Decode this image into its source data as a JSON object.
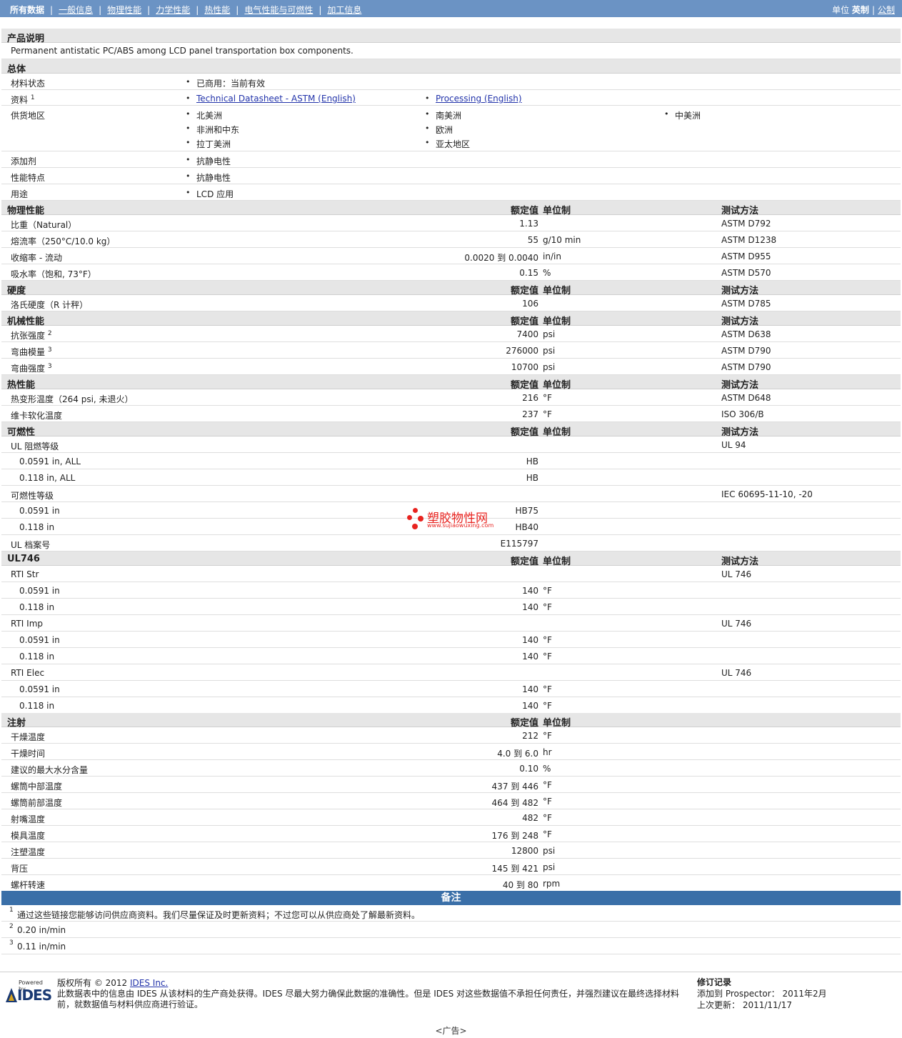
{
  "nav": {
    "tabs": [
      "所有数据",
      "一般信息",
      "物理性能",
      "力学性能",
      "热性能",
      "电气性能与可燃性",
      "加工信息"
    ],
    "units_label": "单位",
    "unit_selected": "英制",
    "unit_other": "公制"
  },
  "product": {
    "title": "产品说明",
    "description": "Permanent antistatic PC/ABS among LCD panel transportation box components."
  },
  "general": {
    "title": "总体",
    "material_status_label": "材料状态",
    "material_status": "已商用：当前有效",
    "docs_label": "资料",
    "docs_sup": "1",
    "doc1": "Technical Datasheet - ASTM (English)",
    "doc2": "Processing (English)",
    "region_label": "供货地区",
    "regions": [
      "北美洲",
      "南美洲",
      "中美洲",
      "非洲和中东",
      "欧洲",
      "拉丁美洲",
      "亚太地区"
    ],
    "additive_label": "添加剂",
    "additive": "抗静电性",
    "feature_label": "性能特点",
    "feature": "抗静电性",
    "use_label": "用途",
    "use": "LCD 应用"
  },
  "col": {
    "nominal": "额定值",
    "unit": "单位制",
    "test": "测试方法"
  },
  "physical": {
    "title": "物理性能",
    "rows": [
      {
        "label": "比重（Natural）",
        "nominal": "1.13",
        "unit": "",
        "test": "ASTM D792"
      },
      {
        "label": "熔流率（250°C/10.0 kg）",
        "nominal": "55",
        "unit": "g/10 min",
        "test": "ASTM D1238"
      },
      {
        "label": "收缩率 - 流动",
        "nominal": "0.0020 到  0.0040",
        "unit": "in/in",
        "test": "ASTM D955"
      },
      {
        "label": "吸水率（饱和, 73°F）",
        "nominal": "0.15",
        "unit": "%",
        "test": "ASTM D570"
      }
    ]
  },
  "hardness": {
    "title": "硬度",
    "rows": [
      {
        "label": "洛氏硬度（R 计秤）",
        "nominal": "106",
        "unit": "",
        "test": "ASTM D785"
      }
    ]
  },
  "mechanical": {
    "title": "机械性能",
    "rows": [
      {
        "label": "抗张强度",
        "sup": "2",
        "nominal": "7400",
        "unit": "psi",
        "test": "ASTM D638"
      },
      {
        "label": "弯曲模量",
        "sup": "3",
        "nominal": "276000",
        "unit": "psi",
        "test": "ASTM D790"
      },
      {
        "label": "弯曲强度",
        "sup": "3",
        "nominal": "10700",
        "unit": "psi",
        "test": "ASTM D790"
      }
    ]
  },
  "thermal": {
    "title": "热性能",
    "rows": [
      {
        "label": "热变形温度（264 psi, 未退火）",
        "nominal": "216",
        "unit": "°F",
        "test": "ASTM D648"
      },
      {
        "label": "维卡软化温度",
        "nominal": "237",
        "unit": "°F",
        "test": "ISO 306/B"
      }
    ]
  },
  "flammability": {
    "title": "可燃性",
    "rows": [
      {
        "label": "UL 阻燃等级",
        "nominal": "",
        "unit": "",
        "test": "UL 94",
        "sub": false
      },
      {
        "label": "0.0591 in, ALL",
        "nominal": "HB",
        "unit": "",
        "test": "",
        "sub": true
      },
      {
        "label": "0.118 in, ALL",
        "nominal": "HB",
        "unit": "",
        "test": "",
        "sub": true
      },
      {
        "label": "可燃性等级",
        "nominal": "",
        "unit": "",
        "test": "IEC 60695-11-10, -20",
        "sub": false
      },
      {
        "label": "0.0591 in",
        "nominal": "HB75",
        "unit": "",
        "test": "",
        "sub": true
      },
      {
        "label": "0.118 in",
        "nominal": "HB40",
        "unit": "",
        "test": "",
        "sub": true
      },
      {
        "label": "UL 档案号",
        "nominal": "E115797",
        "unit": "",
        "test": "",
        "sub": false
      }
    ]
  },
  "ul746": {
    "title": "UL746",
    "rows": [
      {
        "label": "RTI Str",
        "nominal": "",
        "unit": "",
        "test": "UL 746",
        "sub": false
      },
      {
        "label": "0.0591 in",
        "nominal": "140",
        "unit": "°F",
        "test": "",
        "sub": true
      },
      {
        "label": "0.118 in",
        "nominal": "140",
        "unit": "°F",
        "test": "",
        "sub": true
      },
      {
        "label": "RTI Imp",
        "nominal": "",
        "unit": "",
        "test": "UL 746",
        "sub": false
      },
      {
        "label": "0.0591 in",
        "nominal": "140",
        "unit": "°F",
        "test": "",
        "sub": true
      },
      {
        "label": "0.118 in",
        "nominal": "140",
        "unit": "°F",
        "test": "",
        "sub": true
      },
      {
        "label": "RTI Elec",
        "nominal": "",
        "unit": "",
        "test": "UL 746",
        "sub": false
      },
      {
        "label": "0.0591 in",
        "nominal": "140",
        "unit": "°F",
        "test": "",
        "sub": true
      },
      {
        "label": "0.118 in",
        "nominal": "140",
        "unit": "°F",
        "test": "",
        "sub": true
      }
    ]
  },
  "injection": {
    "title": "注射",
    "rows": [
      {
        "label": "干燥温度",
        "nominal": "212",
        "unit": "°F"
      },
      {
        "label": "干燥时间",
        "nominal": "4.0 到  6.0",
        "unit": "hr"
      },
      {
        "label": "建议的最大水分含量",
        "nominal": "0.10",
        "unit": "%"
      },
      {
        "label": "螺筒中部温度",
        "nominal": "437 到  446",
        "unit": "°F"
      },
      {
        "label": "螺筒前部温度",
        "nominal": "464 到  482",
        "unit": "°F"
      },
      {
        "label": "射嘴温度",
        "nominal": "482",
        "unit": "°F"
      },
      {
        "label": "模具温度",
        "nominal": "176 到  248",
        "unit": "°F"
      },
      {
        "label": "注塑温度",
        "nominal": "12800",
        "unit": "psi"
      },
      {
        "label": "背压",
        "nominal": "145 到  421",
        "unit": "psi"
      },
      {
        "label": "螺杆转速",
        "nominal": "40 到  80",
        "unit": "rpm"
      }
    ]
  },
  "notes": {
    "title": "备注",
    "items": [
      {
        "num": "1",
        "text": "通过这些链接您能够访问供应商资料。我们尽量保证及时更新资料；不过您可以从供应商处了解最新资料。"
      },
      {
        "num": "2",
        "text": "0.20 in/min"
      },
      {
        "num": "3",
        "text": "0.11 in/min"
      }
    ]
  },
  "footer": {
    "powered_by": "Powered by",
    "logo_text": "IDES",
    "copyright_prefix": "版权所有  © 2012 ",
    "company_link": "IDES Inc.",
    "disclaimer": "此数据表中的信息由  IDES 从该材料的生产商处获得。IDES 尽最大努力确保此数据的准确性。但是  IDES 对这些数据值不承担任何责任，并强烈建议在最终选择材料前，就数据值与材料供应商进行验证。",
    "revision_title": "修订记录",
    "added_line": "添加到  Prospector：  2011年2月",
    "updated_line": "上次更新：   2011/11/17",
    "ad": "<广告>"
  },
  "watermark": {
    "cn": "塑胶物性网",
    "en": "www.sujiaowuxing.com"
  }
}
